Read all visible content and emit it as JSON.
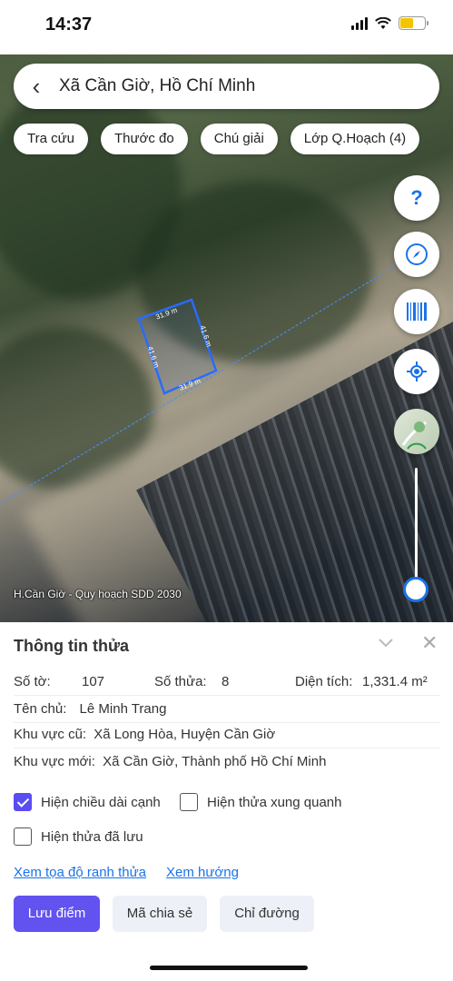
{
  "status": {
    "time": "14:37"
  },
  "search": {
    "title": "Xã Cần Giờ, Hồ Chí Minh"
  },
  "chips": [
    "Tra cứu",
    "Thước đo",
    "Chú giải",
    "Lớp Q.Hoạch (4)"
  ],
  "controls": {
    "help": "?"
  },
  "map": {
    "plan_label": "H.Cần Giờ - Quy hoạch SDD 2030",
    "edges": [
      "31.9 m",
      "41.6 m",
      "31.9 m",
      "41.6 m"
    ],
    "zoom_level": 0.05
  },
  "sheet": {
    "title": "Thông tin thửa",
    "so_to_label": "Số tờ:",
    "so_to": "107",
    "so_thua_label": "Số thửa:",
    "so_thua": "8",
    "dien_tich_label": "Diện tích:",
    "dien_tich": "1,331.4 m²",
    "ten_chu_label": "Tên chủ:",
    "ten_chu": "Lê Minh Trang",
    "khu_vuc_cu_label": "Khu vực cũ:",
    "khu_vuc_cu": "Xã Long Hòa, Huyện Cần Giờ",
    "khu_vuc_moi_label": "Khu vực mới:",
    "khu_vuc_moi": "Xã Cần Giờ, Thành phố Hồ Chí Minh",
    "opt_edge_length": "Hiện chiều dài cạnh",
    "opt_surrounding": "Hiện thửa xung quanh",
    "opt_saved": "Hiện thửa đã lưu",
    "link_coords": "Xem tọa độ ranh thửa",
    "link_direction": "Xem hướng",
    "btn_save": "Lưu điểm",
    "btn_share": "Mã chia sẻ",
    "btn_route": "Chỉ đường"
  },
  "colors": {
    "accent": "#6252f0",
    "link": "#1a73e8",
    "parcel": "#2a6bff"
  }
}
